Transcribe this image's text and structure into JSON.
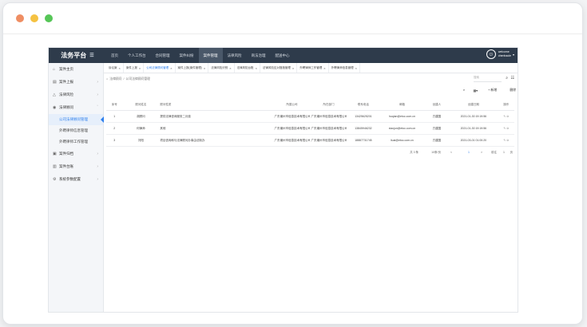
{
  "header": {
    "brand": "法务平台",
    "nav": [
      "首页",
      "个人工作台",
      "合同管理",
      "案件纠纷",
      "案件管理",
      "法律风险",
      "商法治理",
      "配送中心"
    ],
    "active_nav": "案件管理",
    "user_line1": "welcome",
    "user_line2": "chenhaole"
  },
  "sidebar": {
    "items": [
      {
        "label": "案件主页"
      },
      {
        "label": "案件上报"
      },
      {
        "label": "法律风险"
      },
      {
        "label": "法律顾问"
      }
    ],
    "subitems": [
      "公司法律顾问管理",
      "外聘律师信息管理",
      "外聘律师工作管理"
    ],
    "items_after": [
      {
        "label": "案件归档"
      },
      {
        "label": "案件台账"
      },
      {
        "label": "系统参数配置"
      }
    ]
  },
  "tabs": [
    {
      "label": "诉讼案",
      "active": false
    },
    {
      "label": "案件上报",
      "active": false
    },
    {
      "label": "公司法律顾问管理",
      "active": true
    },
    {
      "label": "案件上报(案件管理)",
      "active": false
    },
    {
      "label": "法律风险识别",
      "active": false
    },
    {
      "label": "法律风险台账",
      "active": false
    },
    {
      "label": "法律风险应对措施管理",
      "active": false
    },
    {
      "label": "外聘律师工作管理",
      "active": false
    },
    {
      "label": "外聘律师信息管理",
      "active": false
    }
  ],
  "breadcrumb": {
    "root": "法律顾问",
    "sep": "/",
    "current": "公司法律顾问管理"
  },
  "search": {
    "placeholder": "搜索"
  },
  "toolbar": {
    "add": "+ 新增",
    "delete": "删除"
  },
  "table": {
    "columns": [
      "序号",
      "顾问姓名",
      "顾问性质",
      "所属公司",
      "所在部门",
      "联系电话",
      "邮箱",
      "创建人",
      "创建日期",
      "操作"
    ],
    "rows": [
      {
        "no": "1",
        "name": "胡顾问",
        "type": "提供法律咨询服务二月费",
        "company": "广东潮州市信息技术有限公司",
        "dept": "广东潮州市信息技术有限公司",
        "phone": "13425625201",
        "email": "huqian@etoc.com.cn",
        "creator": "方建国",
        "date": "2021-01-30 19:19:56",
        "ops": "✎ ⊘"
      },
      {
        "no": "2",
        "name": "何律师",
        "type": "其他",
        "company": "广东潮州市信息技术有限公司",
        "dept": "广东潮州市信息技术有限公司",
        "phone": "13845946232",
        "email": "xiaojun@etoc.com.cn",
        "creator": "方建国",
        "date": "2021-01-30 19:19:56",
        "ops": "✎ ⊘"
      },
      {
        "no": "3",
        "name": "刘阳",
        "type": "项目咨询和与法律顾问办事由法制办",
        "company": "广东潮州市信息技术有限公司",
        "dept": "广东潮州市信息技术有限公司",
        "phone": "18887731745",
        "email": "liuai@etoc.com.cn",
        "creator": "方建国",
        "date": "2021-03-01 01:00:20",
        "ops": "✎ ⊘"
      }
    ]
  },
  "pager": {
    "total": "共 3 条",
    "size": "10条/页",
    "prev": "<",
    "page": "1",
    "next": ">",
    "goto_prefix": "前往",
    "goto_page": "1",
    "goto_suffix": "页"
  }
}
